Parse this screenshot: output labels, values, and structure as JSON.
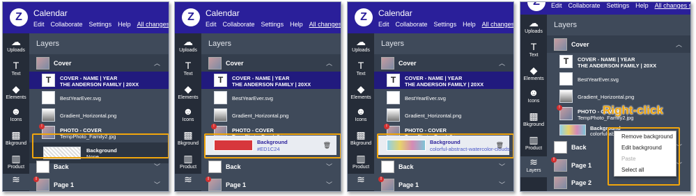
{
  "app": {
    "title": "Calendar",
    "logo_glyph": "Z"
  },
  "menu": {
    "edit": "Edit",
    "collaborate": "Collaborate",
    "settings": "Settings",
    "help": "Help",
    "saved": "All changes saved"
  },
  "sidebar": {
    "uploads": "Uploads",
    "text": "Text",
    "elements": "Elements",
    "icons": "Icons",
    "bkground": "Bkground",
    "product": "Product",
    "layers": "Layers"
  },
  "panel": {
    "title": "Layers"
  },
  "groups": {
    "cover": "Cover",
    "back": "Back",
    "page1": "Page 1",
    "page2": "Page 2"
  },
  "layers": {
    "text_line1": "COVER - NAME | YEAR",
    "text_line2": "THE ANDERSON FAMILY | 20XX",
    "svg_name": "BestYearEver.svg",
    "gradient_name": "Gradient_Horizontal.png",
    "photo_line1": "PHOTO - COVER",
    "photo_line2": "TempPhoto_Family2.jpg",
    "background_label": "Background",
    "bg_none": "None",
    "bg_color": "#ED1C24",
    "bg_image": "colorful-abstract-watercolor-clouds..."
  },
  "context_menu": {
    "remove": "Remove background",
    "edit": "Edit background",
    "paste": "Paste",
    "select_all": "Select all"
  },
  "annotation": {
    "callout": "Right-click"
  },
  "colors": {
    "accent": "#2a1f9a",
    "highlight": "#f2a60c",
    "panel": "#3f4a5a",
    "swatch_red": "#D7373C"
  }
}
